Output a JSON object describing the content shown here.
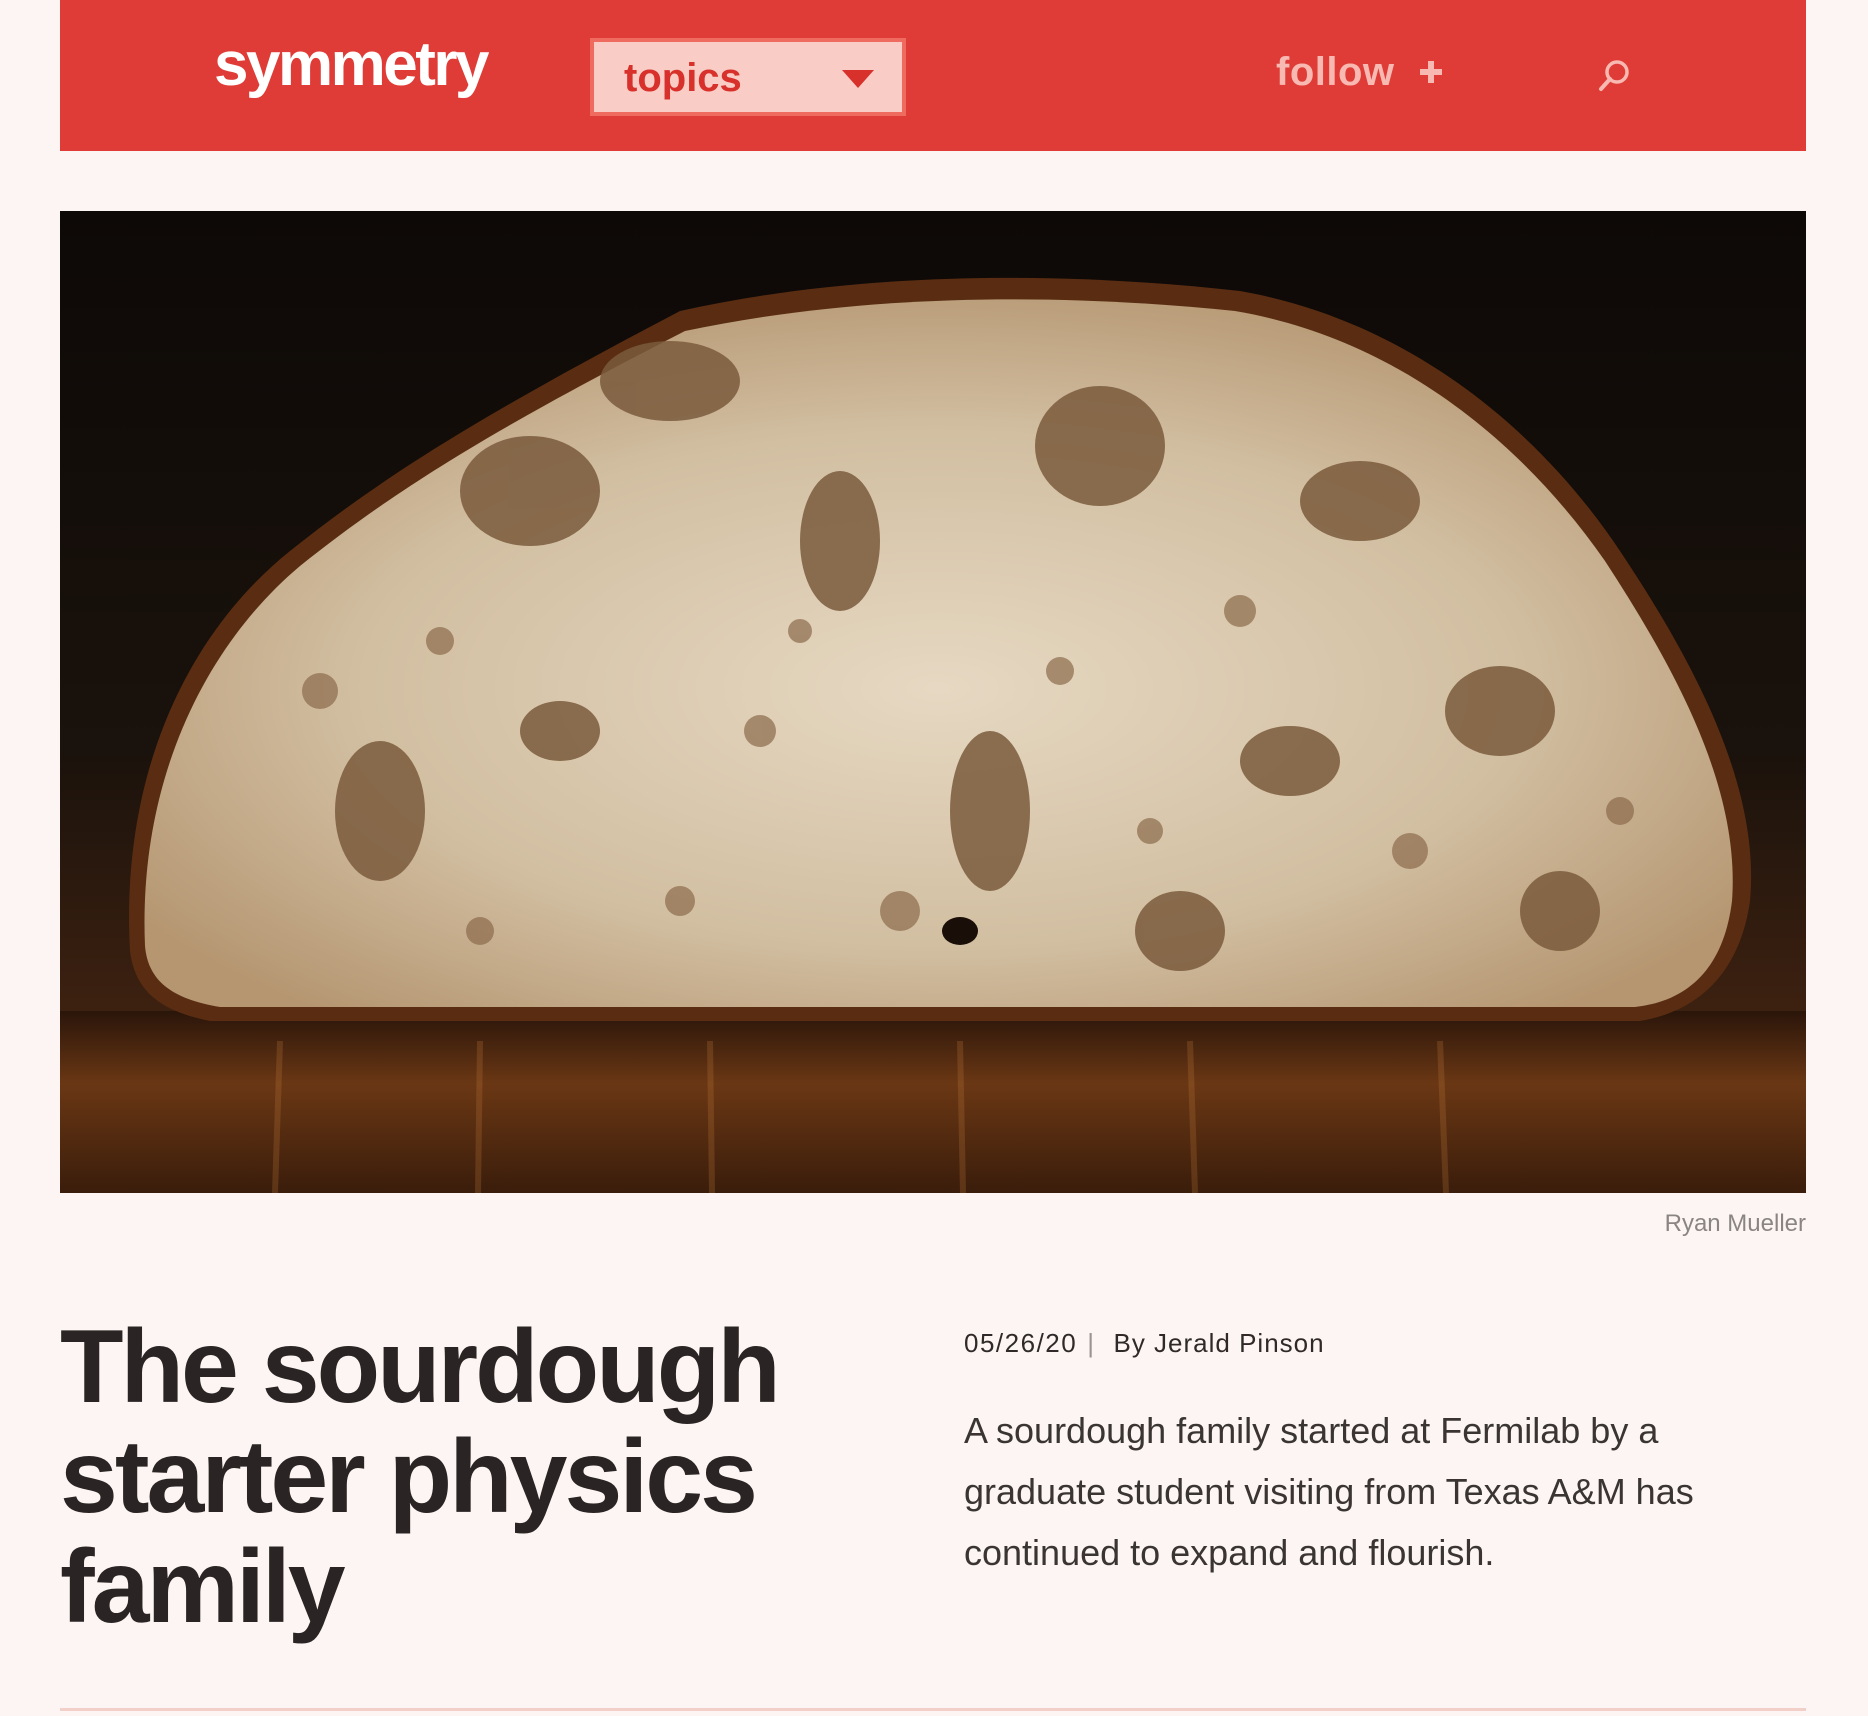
{
  "header": {
    "logo": "symmetry",
    "topics_label": "topics",
    "follow_label": "follow",
    "icons": {
      "topics_dropdown": "caret-down-icon",
      "follow": "plus-icon",
      "search": "search-icon"
    }
  },
  "hero": {
    "credit": "Ryan Mueller"
  },
  "article": {
    "title": "The sourdough starter physics family",
    "date": "05/26/20",
    "separator": "|",
    "byline": "By Jerald Pinson",
    "summary": "A sourdough family started at Fermilab by a graduate student visiting from Texas A&M has continued to expand and flourish."
  },
  "colors": {
    "brand_red": "#e03c37",
    "page_background": "#fcf5f3",
    "topics_box": "#f9cdc6",
    "follow_text": "#f7b9b1",
    "title_text": "#2a2524"
  }
}
